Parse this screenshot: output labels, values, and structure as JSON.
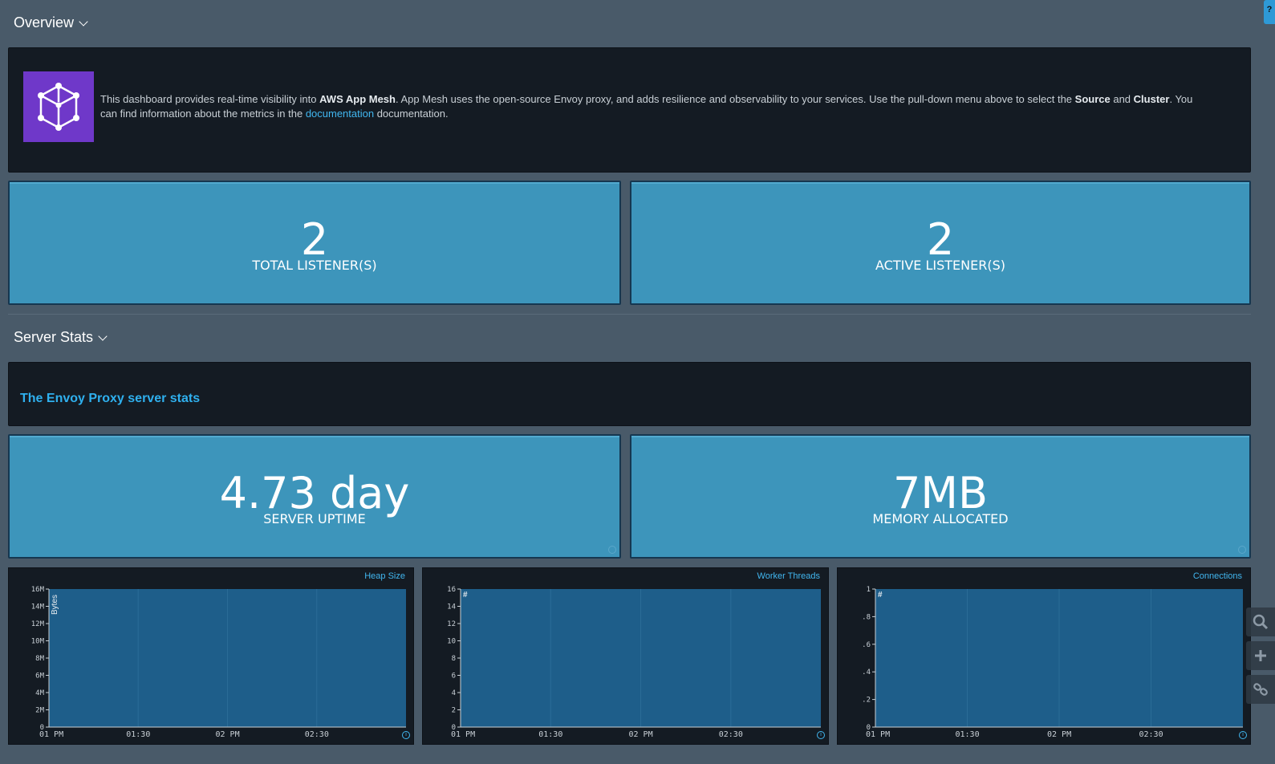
{
  "help_tab": {
    "label": "?"
  },
  "overview": {
    "title": "Overview",
    "intro": {
      "pre": "This dashboard provides real-time visibility into ",
      "bold1": "AWS App Mesh",
      "mid1": ". App Mesh uses the open-source Envoy proxy, and adds resilience and observability to your services. Use the pull-down menu above to select the ",
      "bold2": "Source",
      "mid2": " and ",
      "bold3": "Cluster",
      "mid3": ". You can find information about the metrics in the ",
      "link": "documentation",
      "post": " documentation."
    },
    "stats": [
      {
        "value": "2",
        "label": "TOTAL LISTENER(S)"
      },
      {
        "value": "2",
        "label": "ACTIVE LISTENER(S)"
      }
    ]
  },
  "server_stats": {
    "title": "Server Stats",
    "banner": "The Envoy Proxy server stats",
    "stats": [
      {
        "value": "4.73 day",
        "label": "SERVER UPTIME"
      },
      {
        "value": "7MB",
        "label": "MEMORY ALLOCATED"
      }
    ]
  },
  "colors": {
    "background": "#495a69",
    "panel": "#141b23",
    "stat": "#3d95bb",
    "accent": "#41b6ef",
    "logo": "#6f38c9",
    "plot": "#1e5e8a"
  },
  "icons": [
    "chevron-down-icon",
    "app-mesh-logo-icon",
    "search-icon",
    "plus-icon",
    "link-icon",
    "info-icon"
  ],
  "chart_data": [
    {
      "type": "line",
      "title": "Heap Size",
      "ylabel": "Bytes",
      "xlabel": "",
      "x_ticks": [
        "01 PM",
        "01:30",
        "02 PM",
        "02:30"
      ],
      "y_ticks": [
        "0",
        "2M",
        "4M",
        "6M",
        "8M",
        "10M",
        "12M",
        "14M",
        "16M"
      ],
      "ylim": [
        0,
        16
      ],
      "series": []
    },
    {
      "type": "line",
      "title": "Worker Threads",
      "ylabel": "#",
      "xlabel": "",
      "x_ticks": [
        "01 PM",
        "01:30",
        "02 PM",
        "02:30"
      ],
      "y_ticks": [
        "0",
        "2",
        "4",
        "6",
        "8",
        "10",
        "12",
        "14",
        "16"
      ],
      "ylim": [
        0,
        16
      ],
      "series": []
    },
    {
      "type": "line",
      "title": "Connections",
      "ylabel": "#",
      "xlabel": "",
      "x_ticks": [
        "01 PM",
        "01:30",
        "02 PM",
        "02:30"
      ],
      "y_ticks": [
        "0",
        ".2",
        ".4",
        ".6",
        ".8",
        "1"
      ],
      "ylim": [
        0,
        1
      ],
      "series": []
    }
  ]
}
